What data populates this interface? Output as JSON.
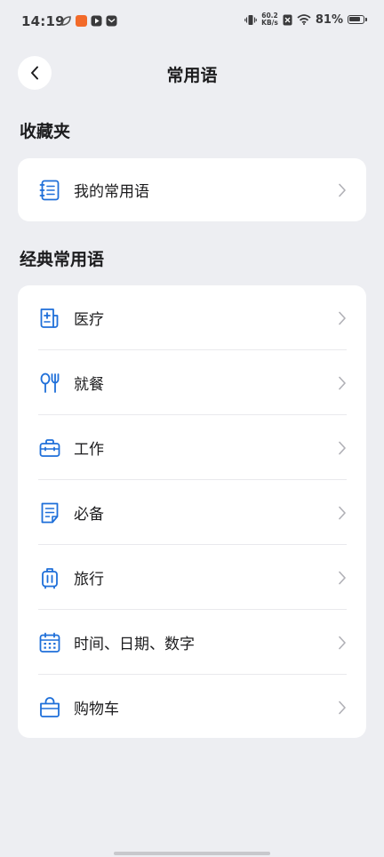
{
  "status_bar": {
    "time": "14:19",
    "net_speed_value": "60.2",
    "net_speed_unit": "KB/s",
    "battery": "81%"
  },
  "header": {
    "title": "常用语"
  },
  "favorites": {
    "title": "收藏夹",
    "items": [
      {
        "label": "我的常用语",
        "icon": "notebook-icon"
      }
    ]
  },
  "classic": {
    "title": "经典常用语",
    "items": [
      {
        "label": "医疗",
        "icon": "medical-icon"
      },
      {
        "label": "就餐",
        "icon": "dining-icon"
      },
      {
        "label": "工作",
        "icon": "briefcase-icon"
      },
      {
        "label": "必备",
        "icon": "document-icon"
      },
      {
        "label": "旅行",
        "icon": "luggage-icon"
      },
      {
        "label": "时间、日期、数字",
        "icon": "calendar-icon"
      },
      {
        "label": "购物车",
        "icon": "shopping-bag-icon"
      }
    ]
  },
  "colors": {
    "accent": "#1E6FD9",
    "background": "#EDEEF2",
    "card": "#FFFFFF"
  }
}
